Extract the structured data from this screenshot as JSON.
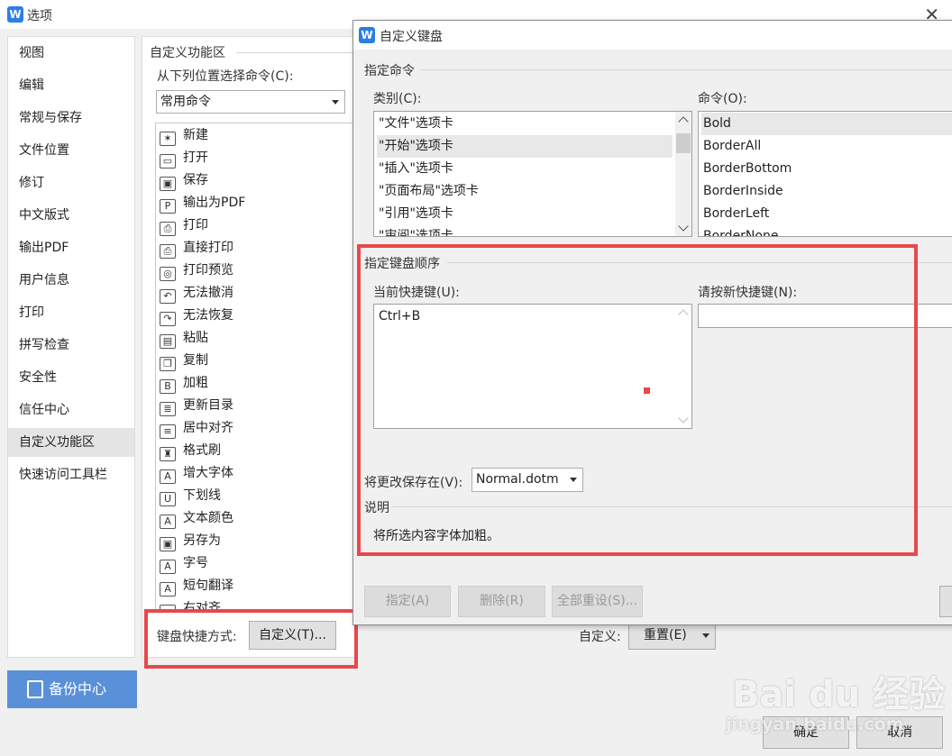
{
  "options_window": {
    "title": "选项",
    "app_icon": "W",
    "nav": [
      "视图",
      "编辑",
      "常规与保存",
      "文件位置",
      "修订",
      "中文版式",
      "输出PDF",
      "用户信息",
      "打印",
      "拼写检查",
      "安全性",
      "信任中心",
      "自定义功能区",
      "快速访问工具栏"
    ],
    "active_nav": "自定义功能区",
    "backup_label": "备份中心",
    "section_title": "自定义功能区",
    "choose_from_label": "从下列位置选择命令(C):",
    "choose_from_value": "常用命令",
    "commands": [
      {
        "icon": "new-icon",
        "glyph": "✶",
        "label": "新建"
      },
      {
        "icon": "open-folder-icon",
        "glyph": "▭",
        "label": "打开"
      },
      {
        "icon": "save-icon",
        "glyph": "▣",
        "label": "保存"
      },
      {
        "icon": "pdf-export-icon",
        "glyph": "P",
        "label": "输出为PDF"
      },
      {
        "icon": "print-icon",
        "glyph": "⎙",
        "label": "打印"
      },
      {
        "icon": "direct-print-icon",
        "glyph": "⎙",
        "label": "直接打印"
      },
      {
        "icon": "print-preview-icon",
        "glyph": "◎",
        "label": "打印预览"
      },
      {
        "icon": "undo-icon",
        "glyph": "↶",
        "label": "无法撤消"
      },
      {
        "icon": "redo-icon",
        "glyph": "↷",
        "label": "无法恢复"
      },
      {
        "icon": "paste-icon",
        "glyph": "▤",
        "label": "粘贴"
      },
      {
        "icon": "copy-icon",
        "glyph": "❐",
        "label": "复制"
      },
      {
        "icon": "bold-icon",
        "glyph": "B",
        "label": "加粗"
      },
      {
        "icon": "toc-update-icon",
        "glyph": "≣",
        "label": "更新目录"
      },
      {
        "icon": "align-center-icon",
        "glyph": "≡",
        "label": "居中对齐"
      },
      {
        "icon": "format-painter-icon",
        "glyph": "♜",
        "label": "格式刷"
      },
      {
        "icon": "font-grow-icon",
        "glyph": "A",
        "label": "增大字体"
      },
      {
        "icon": "underline-icon",
        "glyph": "U",
        "label": "下划线"
      },
      {
        "icon": "font-color-icon",
        "glyph": "A",
        "label": "文本颜色"
      },
      {
        "icon": "save-as-icon",
        "glyph": "▣",
        "label": "另存为"
      },
      {
        "icon": "font-size-icon",
        "glyph": "A",
        "label": "字号"
      },
      {
        "icon": "translate-icon",
        "glyph": "A",
        "label": "短句翻译"
      },
      {
        "icon": "align-right-icon",
        "glyph": "≡",
        "label": "右对齐"
      }
    ],
    "keyboard_shortcut_label": "键盘快捷方式:",
    "customize_button": "自定义(T)...",
    "custom_label": "自定义:",
    "reset_button": "重置(E)",
    "ok_button": "确定",
    "cancel_button": "取消"
  },
  "keyboard_dialog": {
    "title": "自定义键盘",
    "app_icon": "W",
    "specify_command": "指定命令",
    "categories_label": "类别(C):",
    "categories": [
      "\"文件\"选项卡",
      "\"开始\"选项卡",
      "\"插入\"选项卡",
      "\"页面布局\"选项卡",
      "\"引用\"选项卡",
      "\"审阅\"选项卡"
    ],
    "selected_category": "\"开始\"选项卡",
    "commands_label": "命令(O):",
    "commands": [
      "Bold",
      "BorderAll",
      "BorderBottom",
      "BorderInside",
      "BorderLeft",
      "BorderNone"
    ],
    "selected_command": "Bold",
    "specify_sequence": "指定键盘顺序",
    "current_keys_label": "当前快捷键(U):",
    "current_keys": [
      "Ctrl+B"
    ],
    "new_key_label": "请按新快捷键(N):",
    "new_key_value": "",
    "save_in_label": "将更改保存在(V):",
    "save_in_value": "Normal.dotm",
    "description_label": "说明",
    "description_text": "将所选内容字体加粗。",
    "assign_button": "指定(A)",
    "remove_button": "删除(R)",
    "reset_all_button": "全部重设(S)..."
  },
  "watermark": {
    "logo": "Bai du 经验",
    "url": "jingyan.baidu.com"
  },
  "colors": {
    "highlight_red": "#e8484b",
    "backup_blue": "#5a90d8",
    "app_blue": "#2b7de9"
  }
}
